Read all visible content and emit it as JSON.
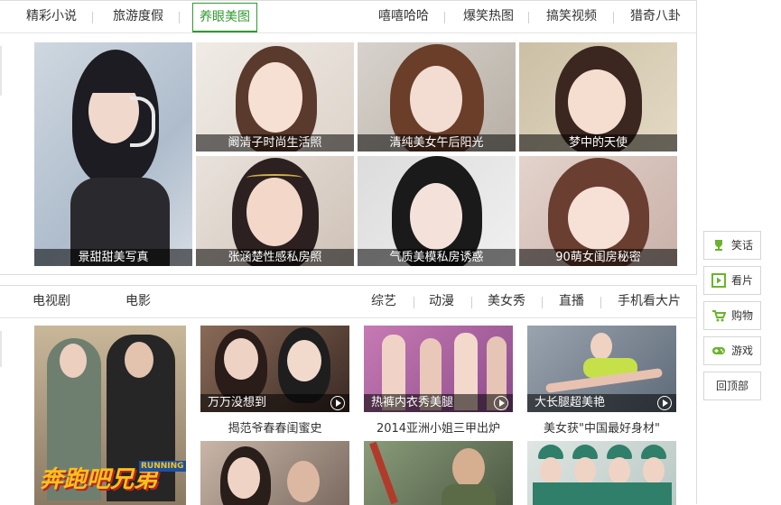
{
  "section1": {
    "tabs_left": [
      "精彩小说",
      "旅游度假",
      "养眼美图"
    ],
    "active_tab": "养眼美图",
    "tabs_right": [
      "嘻嘻哈哈",
      "爆笑热图",
      "搞笑视频",
      "猎奇八卦"
    ],
    "photos": [
      {
        "caption": "景甜甜美写真"
      },
      {
        "caption": "阚清子时尚生活照"
      },
      {
        "caption": "清纯美女午后阳光"
      },
      {
        "caption": "梦中的天使"
      },
      {
        "caption": "张涵楚性感私房照"
      },
      {
        "caption": "气质美模私房诱惑"
      },
      {
        "caption": "90萌女闺房秘密"
      }
    ]
  },
  "section2": {
    "tabs_left": [
      "电视剧",
      "电影"
    ],
    "tabs_right": [
      "综艺",
      "动漫",
      "美女秀",
      "直播",
      "手机看大片"
    ],
    "videos": [
      {
        "overlay": "万万没想到",
        "title": "揭范爷春春闺蜜史"
      },
      {
        "overlay": "热裤内衣秀美腿",
        "title": "2014亚洲小姐三甲出炉"
      },
      {
        "overlay": "大长腿超美艳",
        "title": "美女获\"中国最好身材\""
      }
    ],
    "poster_text": "奔跑吧兄弟",
    "poster_badge": "RUNNING MAN"
  },
  "sidebar": {
    "buttons": [
      {
        "label": "笑话",
        "icon": "trophy-icon"
      },
      {
        "label": "看片",
        "icon": "play-icon"
      },
      {
        "label": "购物",
        "icon": "cart-icon"
      },
      {
        "label": "游戏",
        "icon": "gamepad-icon"
      }
    ],
    "back_to_top": "回顶部"
  },
  "colors": {
    "accent": "#2f9a2f",
    "icon_green": "#6ab42d"
  }
}
